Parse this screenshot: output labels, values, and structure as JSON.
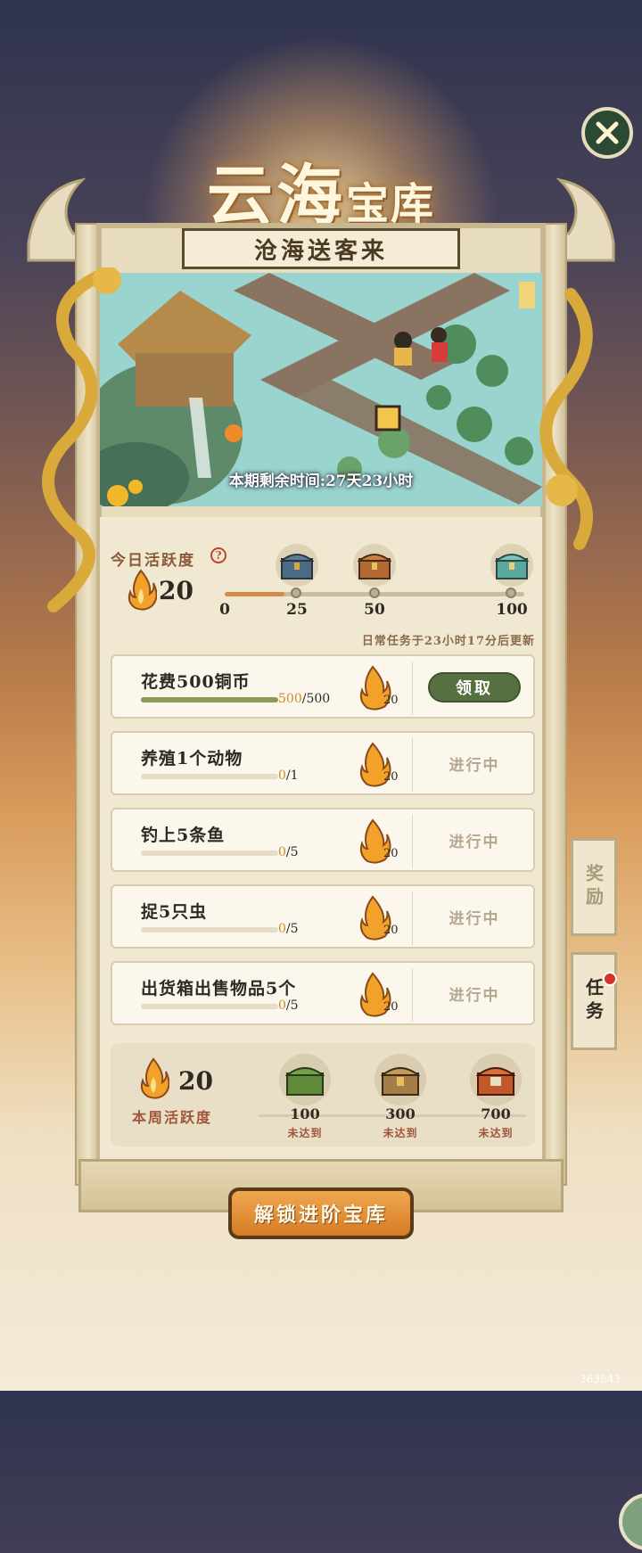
{
  "title": {
    "main": "云海",
    "suffix": "宝库"
  },
  "subtitle": "沧海送客来",
  "countdown": "本期剩余时间:27天23小时",
  "daily": {
    "label": "今日活跃度",
    "help": "?",
    "value": "20",
    "progress_fraction": 0.2,
    "milestones": [
      "0",
      "25",
      "50",
      "100"
    ],
    "refresh_note": "日常任务于23小时17分后更新"
  },
  "tasks": [
    {
      "name": "花费500铜币",
      "current": "500",
      "total": "/500",
      "fraction": 1.0,
      "reward": "20",
      "action": "领取"
    },
    {
      "name": "养殖1个动物",
      "current": "0",
      "total": "/1",
      "fraction": 0,
      "reward": "20",
      "action": "进行中"
    },
    {
      "name": "钓上5条鱼",
      "current": "0",
      "total": "/5",
      "fraction": 0,
      "reward": "20",
      "action": "进行中"
    },
    {
      "name": "捉5只虫",
      "current": "0",
      "total": "/5",
      "fraction": 0,
      "reward": "20",
      "action": "进行中"
    },
    {
      "name": "出货箱出售物品5个",
      "current": "0",
      "total": "/5",
      "fraction": 0,
      "reward": "20",
      "action": "进行中"
    }
  ],
  "weekly": {
    "value": "20",
    "label": "本周活跃度",
    "chests": [
      {
        "value": "100",
        "status": "未达到"
      },
      {
        "value": "300",
        "status": "未达到"
      },
      {
        "value": "700",
        "status": "未达到"
      }
    ]
  },
  "unlock_button": "解锁进阶宝库",
  "side_tabs": {
    "reward": "奖励",
    "task": "任务"
  },
  "watermark": "363843",
  "colors": {
    "accent": "#d57b25",
    "claim": "#577041",
    "progress": "#8e9a58",
    "flame": "#f2a22a"
  }
}
